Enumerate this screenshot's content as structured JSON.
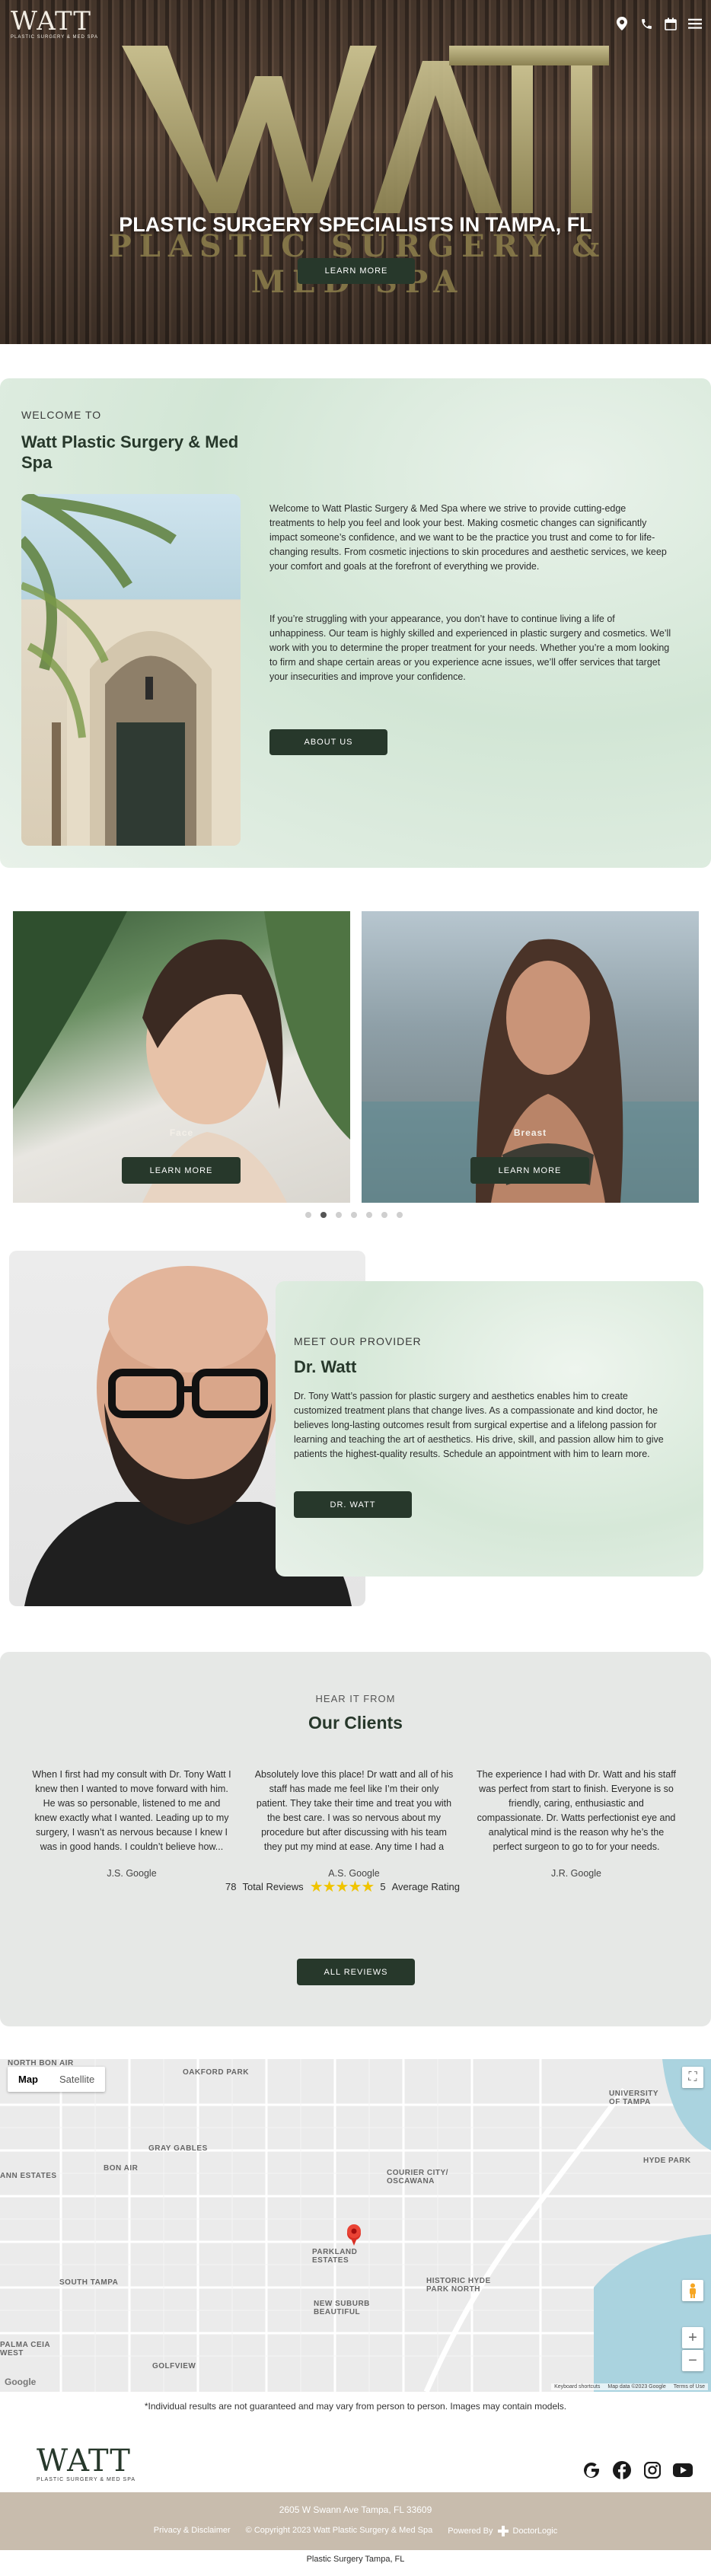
{
  "header": {
    "logo_word": "WATT",
    "logo_sub": "PLASTIC SURGERY & MED SPA",
    "icons": [
      "location-icon",
      "phone-icon",
      "calendar-icon",
      "menu-icon"
    ]
  },
  "hero": {
    "brand_line": "PLASTIC SURGERY & MED SPA",
    "title": "PLASTIC SURGERY SPECIALISTS IN TAMPA, FL",
    "button": "LEARN MORE"
  },
  "welcome": {
    "kicker": "WELCOME TO",
    "title": "Watt Plastic Surgery & Med Spa",
    "p1": "Welcome to Watt Plastic Surgery & Med Spa where we strive to provide cutting-edge treatments to help you feel and look your best. Making cosmetic changes can significantly impact someone’s confidence, and we want to be the practice you trust and come to for life-changing results. From cosmetic injections to skin procedures and aesthetic services, we keep your comfort and goals at the forefront of everything we provide.",
    "p2": "If you’re struggling with your appearance, you don’t have to continue living a life of unhappiness. Our team is highly skilled and experienced in plastic surgery and cosmetics. We’ll work with you to determine the proper treatment for your needs. Whether you’re a mom looking to firm and shape certain areas or you experience acne issues, we’ll offer services that target your insecurities and improve your confidence.",
    "button": "ABOUT US"
  },
  "slider": {
    "slides": [
      {
        "label": "Face",
        "button": "LEARN MORE"
      },
      {
        "label": "Breast",
        "button": "LEARN MORE"
      }
    ],
    "dot_count": 7,
    "active_dot": 2
  },
  "provider": {
    "kicker": "MEET OUR PROVIDER",
    "name": "Dr. Watt",
    "text": "Dr. Tony Watt’s passion for plastic surgery and aesthetics enables him to create customized treatment plans that change lives. As a compassionate and kind doctor, he believes long-lasting outcomes result from surgical expertise and a lifelong passion for learning and teaching the art of aesthetics. His drive, skill, and passion allow him to give patients the highest-quality results. Schedule an appointment with him to learn more.",
    "button": "DR. WATT"
  },
  "reviews": {
    "kicker": "HEAR IT FROM",
    "title": "Our Clients",
    "items": [
      {
        "quote": "When I first had my consult with Dr. Tony Watt I knew then I wanted to move forward with him. He was so personable, listened to me and knew exactly what I wanted. Leading up to my surgery, I wasn’t as nervous because I knew I was in good hands. I couldn’t believe how...",
        "author": "J.S. Google"
      },
      {
        "quote": "Absolutely love this place! Dr watt and all of his staff has made me feel like I’m their only patient. They take their time and treat you with the best care. I was so nervous about my procedure but after discussing with his team they put my mind at ease. Any time I had a concern...",
        "author": "A.S. Google"
      },
      {
        "quote": "The experience I had with Dr. Watt and his staff was perfect from start to finish. Everyone is so friendly, caring, enthusiastic and compassionate. Dr. Watts perfectionist eye and analytical mind is the reason why he’s the perfect surgeon to go to for your needs.",
        "author": "J.R. Google"
      }
    ],
    "total": "78",
    "total_label": "Total Reviews",
    "stars": "★★★★★",
    "rating": "5",
    "rating_label": "Average Rating",
    "button": "ALL REVIEWS"
  },
  "map": {
    "toggle": [
      "Map",
      "Satellite"
    ],
    "labels": [
      "NORTH BON AIR",
      "OAKFORD PARK",
      "UNIVERSITY OF TAMPA",
      "GRAY GABLES",
      "BON AIR",
      "COURIER CITY/ OSCAWANA",
      "HYDE PARK",
      "ANN ESTATES",
      "PARKLAND ESTATES",
      "SOUTH TAMPA",
      "HISTORIC HYDE PARK NORTH",
      "NEW SUBURB BEAUTIFUL",
      "PALMA CEIA WEST",
      "GOLFVIEW"
    ],
    "google": "Google",
    "footer": [
      "Keyboard shortcuts",
      "Map data ©2023 Google",
      "Terms of Use"
    ]
  },
  "disclaimer": "*Individual results are not guaranteed and may vary from person to person. Images may contain models.",
  "footer": {
    "logo_word": "WATT",
    "logo_sub": "PLASTIC SURGERY & MED SPA",
    "social_icons": [
      "google-icon",
      "facebook-icon",
      "instagram-icon",
      "youtube-icon"
    ],
    "address": "2605 W Swann Ave   Tampa, FL 33609",
    "privacy": "Privacy & Disclaimer",
    "copyright": "© Copyright 2023 Watt Plastic Surgery & Med Spa",
    "powered": "Powered By",
    "powered_by": "DoctorLogic",
    "bottom_line": "Plastic Surgery Tampa, FL"
  }
}
